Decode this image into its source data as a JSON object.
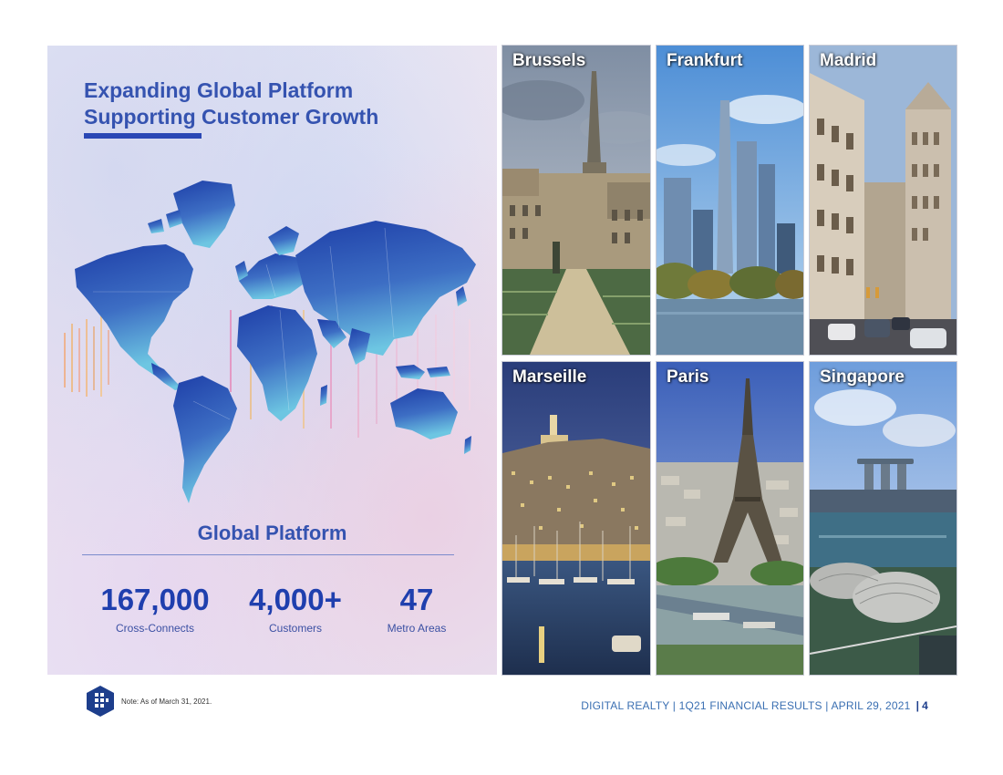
{
  "headline": {
    "line1": "Expanding Global Platform",
    "line2": "Supporting Customer Growth"
  },
  "platform": {
    "title": "Global Platform",
    "stats": [
      {
        "value": "167,000",
        "label": "Cross-Connects"
      },
      {
        "value": "4,000+",
        "label": "Customers"
      },
      {
        "value": "47",
        "label": "Metro Areas"
      }
    ]
  },
  "cities": [
    {
      "name": "Brussels"
    },
    {
      "name": "Frankfurt"
    },
    {
      "name": "Madrid"
    },
    {
      "name": "Marseille"
    },
    {
      "name": "Paris"
    },
    {
      "name": "Singapore"
    }
  ],
  "footer": {
    "note": "Note: As of March 31, 2021.",
    "text": "DIGITAL REALTY | 1Q21 FINANCIAL RESULTS | APRIL 29, 2021",
    "separator": "|",
    "page": "4"
  },
  "colors": {
    "accent": "#2a47b5",
    "stat_blue": "#1f3fae",
    "footer_blue": "#3a6fb2"
  },
  "icons": [
    "digital-realty-logo-icon",
    "world-map-illustration"
  ]
}
